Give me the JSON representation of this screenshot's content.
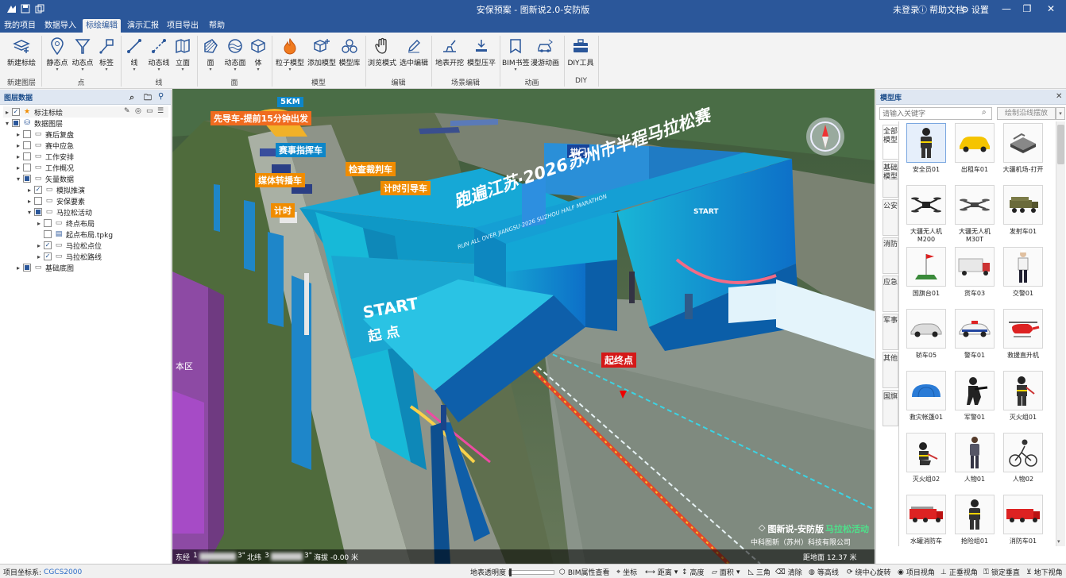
{
  "window": {
    "title": "安保预案 - 图新说2.0-安防版",
    "login": "未登录",
    "help": "帮助文档",
    "settings": "设置"
  },
  "menu": [
    "我的项目",
    "数据导入",
    "标绘编辑",
    "演示汇报",
    "项目导出",
    "帮助"
  ],
  "ribbon": {
    "buttons": [
      {
        "label": "新建标绘",
        "icon": "layers-plus-icon"
      },
      {
        "label": "静态点",
        "icon": "map-pin-icon"
      },
      {
        "label": "动态点",
        "icon": "funnel-point-icon"
      },
      {
        "label": "标签",
        "icon": "label-icon"
      },
      {
        "label": "线",
        "icon": "line-icon"
      },
      {
        "label": "动态线",
        "icon": "dynamic-line-icon"
      },
      {
        "label": "立面",
        "icon": "facade-icon"
      },
      {
        "label": "面",
        "icon": "polygon-icon"
      },
      {
        "label": "动态面",
        "icon": "wave-polygon-icon"
      },
      {
        "label": "体",
        "icon": "cube-icon"
      },
      {
        "label": "粒子模型",
        "icon": "fire-icon"
      },
      {
        "label": "添加模型",
        "icon": "add-model-icon"
      },
      {
        "label": "模型库",
        "icon": "model-library-icon"
      },
      {
        "label": "浏览模式",
        "icon": "hand-icon"
      },
      {
        "label": "选中编辑",
        "icon": "pen-icon"
      },
      {
        "label": "地表开挖",
        "icon": "excavate-icon"
      },
      {
        "label": "模型压平",
        "icon": "flatten-icon"
      },
      {
        "label": "BIM书签",
        "icon": "bookmark-icon"
      },
      {
        "label": "漫游动画",
        "icon": "roam-car-icon"
      },
      {
        "label": "DIY工具",
        "icon": "toolbox-icon"
      }
    ],
    "groups": [
      "新建图层",
      "点",
      "线",
      "面",
      "模型",
      "编辑",
      "场景编辑",
      "动画",
      "DIY"
    ]
  },
  "layers": {
    "title": "图层数据",
    "tree": [
      {
        "label": "标注标绘",
        "checked": "checked",
        "icon": "star-icon"
      },
      {
        "label": "数据图层",
        "checked": "partial",
        "icon": "database-icon"
      },
      {
        "label": "赛后复盘",
        "checked": "none",
        "icon": "folder-icon"
      },
      {
        "label": "赛中应急",
        "checked": "none",
        "icon": "folder-icon"
      },
      {
        "label": "工作安排",
        "checked": "none",
        "icon": "folder-icon"
      },
      {
        "label": "工作概况",
        "checked": "none",
        "icon": "folder-icon"
      },
      {
        "label": "矢量数据",
        "checked": "partial",
        "icon": "folder-icon"
      },
      {
        "label": "模拟推演",
        "checked": "checked",
        "icon": "folder-icon"
      },
      {
        "label": "安保要素",
        "checked": "none",
        "icon": "folder-icon"
      },
      {
        "label": "马拉松活动",
        "checked": "partial",
        "icon": "folder-icon"
      },
      {
        "label": "终点布局",
        "checked": "none",
        "icon": "folder-icon"
      },
      {
        "label": "起点布局.tpkg",
        "checked": "none",
        "icon": "file-icon"
      },
      {
        "label": "马拉松点位",
        "checked": "checked",
        "icon": "folder-icon"
      },
      {
        "label": "马拉松路线",
        "checked": "checked",
        "icon": "folder-icon"
      },
      {
        "label": "基础底图",
        "checked": "partial",
        "icon": "folder-icon"
      }
    ]
  },
  "scene": {
    "labels": {
      "km": "5KM",
      "lead_car": "先导车-提前15分钟出发",
      "command_car": "赛事指挥车",
      "referee_car": "检查裁判车",
      "media_car": "媒体转播车",
      "timing_car1": "计时引导车",
      "timing_car2": "计时",
      "start_finish": "起终点",
      "arch": "拱门",
      "zone": "本区",
      "activity": "马拉松活动"
    },
    "banner": {
      "title": "跑遍江苏·2026苏州市半程马拉松赛",
      "subtitle": "RUN ALL OVER JIANGSU·2026 SUZHOU HALF MARATHON",
      "start": "START",
      "start_cn": "起 点",
      "start2": "START"
    },
    "watermark": {
      "product": "图新说-安防版",
      "company": "中科图新（苏州）科技有限公司"
    },
    "coords": {
      "lon_label": "东经",
      "lon_value": "1",
      "lon_suffix": "3\"",
      "lat_label": "北纬",
      "lat_value": "3",
      "lat_suffix": "3\"",
      "alt": "海拔 -0.00 米",
      "distance": "距地面 12.37 米"
    }
  },
  "model_library": {
    "title": "模型库",
    "search_placeholder": "请输入关键字",
    "draw_button": "绘制沿线摆放",
    "tabs": [
      "全部模型",
      "基础模型",
      "公安",
      "消防",
      "应急",
      "军事",
      "其他",
      "国旗"
    ],
    "items": [
      {
        "label": "安全员01",
        "icon": "firefighter-icon",
        "color": "#333"
      },
      {
        "label": "出租车01",
        "icon": "taxi-icon",
        "color": "#f5c400"
      },
      {
        "label": "大疆机场-打开",
        "icon": "drone-dock-icon",
        "color": "#555"
      },
      {
        "label": "大疆无人机M200",
        "icon": "drone-icon",
        "color": "#222"
      },
      {
        "label": "大疆无人机M30T",
        "icon": "drone-icon",
        "color": "#444"
      },
      {
        "label": "发射车01",
        "icon": "launcher-truck-icon",
        "color": "#6a6a3a"
      },
      {
        "label": "国旗台01",
        "icon": "flag-stand-icon",
        "color": "#c33"
      },
      {
        "label": "货车03",
        "icon": "truck-icon",
        "color": "#ddd"
      },
      {
        "label": "交警01",
        "icon": "police-person-icon",
        "color": "#335"
      },
      {
        "label": "轿车05",
        "icon": "sedan-icon",
        "color": "#ccc"
      },
      {
        "label": "警车01",
        "icon": "police-car-icon",
        "color": "#2346a0"
      },
      {
        "label": "救援直升机",
        "icon": "helicopter-icon",
        "color": "#c22"
      },
      {
        "label": "救灾帐篷01",
        "icon": "tent-icon",
        "color": "#2a7bd6"
      },
      {
        "label": "军警01",
        "icon": "soldier-icon",
        "color": "#222"
      },
      {
        "label": "灭火组01",
        "icon": "firefighter-icon",
        "color": "#333"
      },
      {
        "label": "灭火组02",
        "icon": "firefighter-kneel-icon",
        "color": "#333"
      },
      {
        "label": "人物01",
        "icon": "person-icon",
        "color": "#446"
      },
      {
        "label": "人物02",
        "icon": "cyclist-icon",
        "color": "#333"
      },
      {
        "label": "水罐消防车",
        "icon": "fire-truck-icon",
        "color": "#c22"
      },
      {
        "label": "抢险组01",
        "icon": "firefighter-icon",
        "color": "#333"
      },
      {
        "label": "消防车01",
        "icon": "fire-truck-icon",
        "color": "#c22"
      }
    ]
  },
  "status": {
    "project_crs_label": "项目坐标系:",
    "project_crs": "CGCS2000",
    "items": [
      "地表透明度",
      "BIM属性查看",
      "坐标",
      "距离",
      "高度",
      "面积",
      "三角",
      "清除",
      "等高线",
      "绕中心旋转",
      "项目视角",
      "正垂视角",
      "锁定垂直",
      "地下视角"
    ]
  }
}
